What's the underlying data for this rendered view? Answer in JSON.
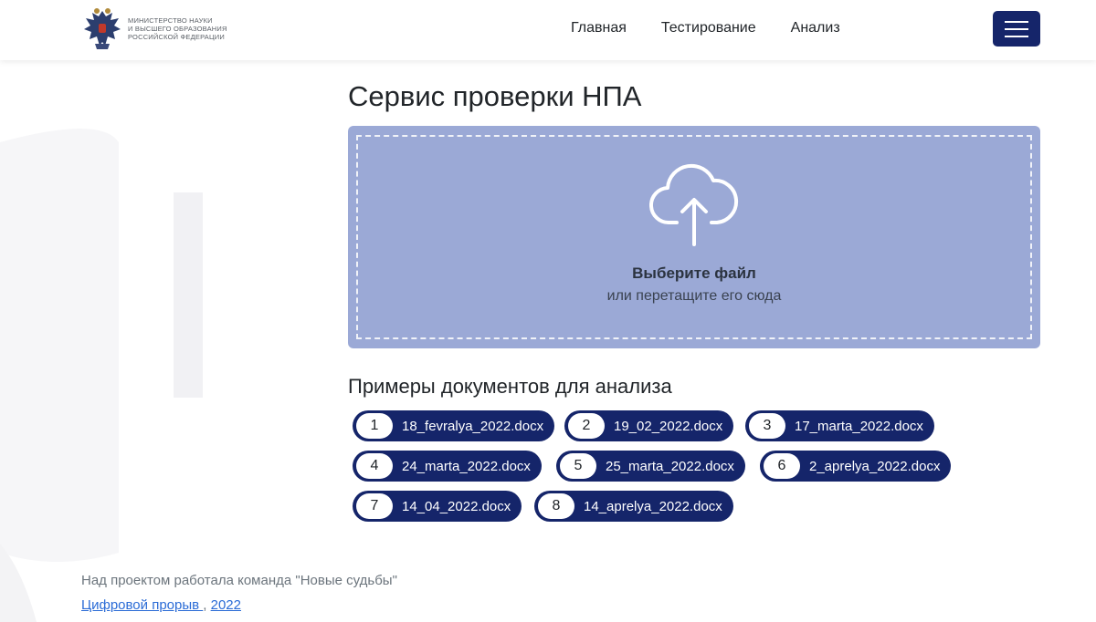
{
  "header": {
    "logo_lines": [
      "МИНИСТЕРСТВО НАУКИ",
      "И ВЫСШЕГО ОБРАЗОВАНИЯ",
      "РОССИЙСКОЙ ФЕДЕРАЦИИ"
    ],
    "logo_icon": "eagle-emblem-icon",
    "nav": [
      {
        "label": "Главная"
      },
      {
        "label": "Тестирование"
      },
      {
        "label": "Анализ"
      }
    ],
    "menu_icon": "hamburger-icon"
  },
  "main": {
    "title": "Сервис проверки НПА",
    "dropzone": {
      "icon": "cloud-upload-icon",
      "title": "Выберите файл",
      "subtitle": "или перетащите его сюда"
    },
    "examples_title": "Примеры документов для анализа",
    "examples": [
      {
        "num": "1",
        "file": "18_fevralya_2022.docx"
      },
      {
        "num": "2",
        "file": "19_02_2022.docx"
      },
      {
        "num": "3",
        "file": "17_marta_2022.docx"
      },
      {
        "num": "4",
        "file": "24_marta_2022.docx"
      },
      {
        "num": "5",
        "file": "25_marta_2022.docx"
      },
      {
        "num": "6",
        "file": "2_aprelya_2022.docx"
      },
      {
        "num": "7",
        "file": "14_04_2022.docx"
      },
      {
        "num": "8",
        "file": "14_aprelya_2022.docx"
      }
    ]
  },
  "footer": {
    "credits": "Над проектом работала команда \"Новые судьбы\"",
    "link1": "Цифровой прорыв ",
    "separator": ",",
    "link2": "2022"
  },
  "colors": {
    "navy": "#15256a",
    "dropzone": "#9ba9d6",
    "link": "#2a6bd6"
  }
}
